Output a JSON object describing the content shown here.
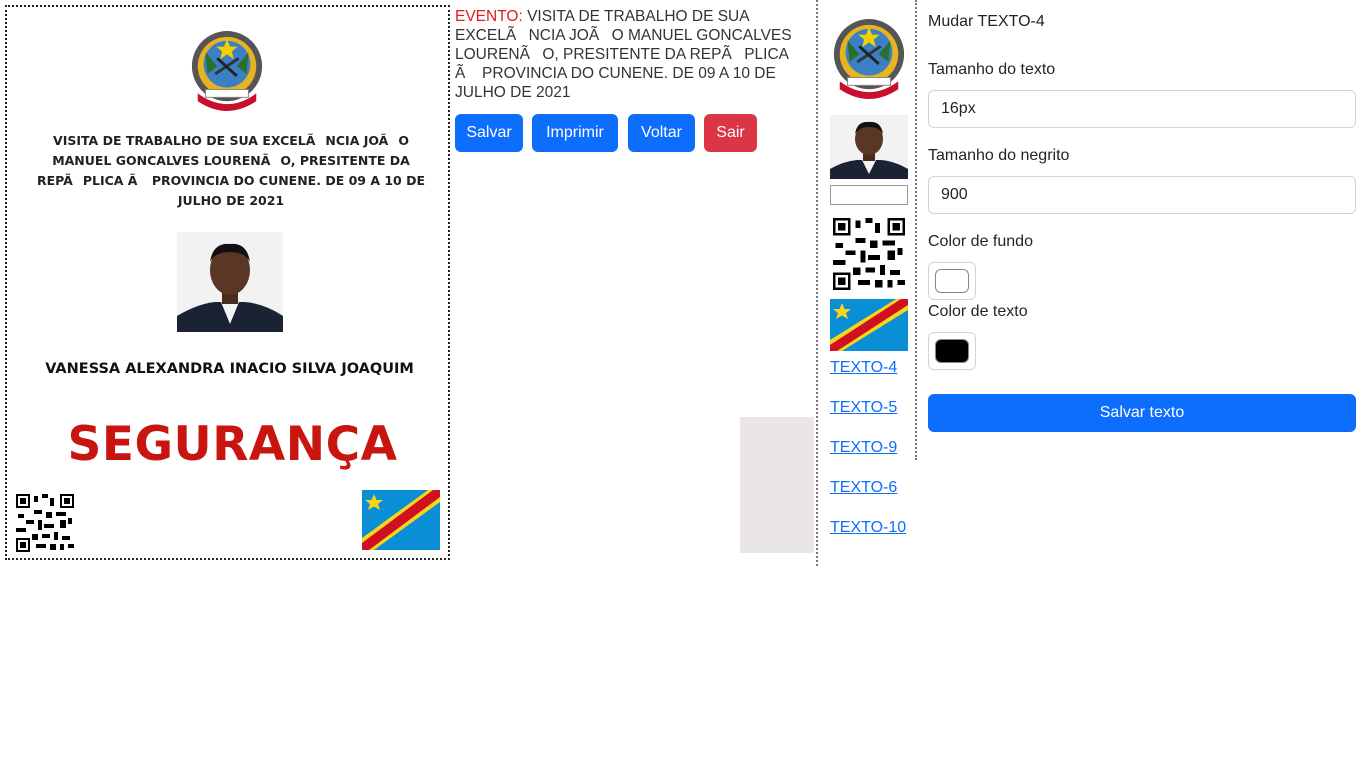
{
  "card": {
    "title": "VISITA DE TRABALHO DE SUA EXCELÃNCIA JOÃO MANUEL GONCALVES LOURENÃO, PRESITENTE DA REPÃPLICA Ã PROVINCIA DO CUNENE. DE 09 A 10 DE JULHO DE 2021",
    "name": "VANESSA ALEXANDRA INACIO SILVA JOAQUIM",
    "role": "SEGURANÇA",
    "role_color": "#c8150f"
  },
  "event": {
    "label": "EVENTO:",
    "text": " VISITA DE TRABALHO DE SUA EXCELÃNCIA JOÃO MANUEL GONCALVES LOURENÃO, PRESITENTE DA REPÃPLICA Ã PROVINCIA DO CUNENE. DE 09 A 10 DE JULHO DE 2021"
  },
  "actions": {
    "save": "Salvar",
    "print": "Imprimir",
    "back": "Voltar",
    "exit": "Sair"
  },
  "sidebar": {
    "thumbs": [
      "coat-of-arms-icon",
      "portrait-photo",
      "broken-image-icon",
      "qr-code-icon",
      "flag-icon"
    ],
    "links": [
      "TEXTO-4",
      "TEXTO-5",
      "TEXTO-9",
      "TEXTO-6",
      "TEXTO-10"
    ]
  },
  "form": {
    "title": "Mudar TEXTO-4",
    "size_label": "Tamanho do texto",
    "size_value": "16px",
    "bold_label": "Tamanho do negrito",
    "bold_value": "900",
    "bg_label": "Color de fundo",
    "bg_value": "#ffffff",
    "fg_label": "Color de texto",
    "fg_value": "#000000",
    "submit": "Salvar texto"
  },
  "colors": {
    "primary": "#0d6efd",
    "danger": "#dc3545",
    "event_label": "#e31b1b"
  }
}
